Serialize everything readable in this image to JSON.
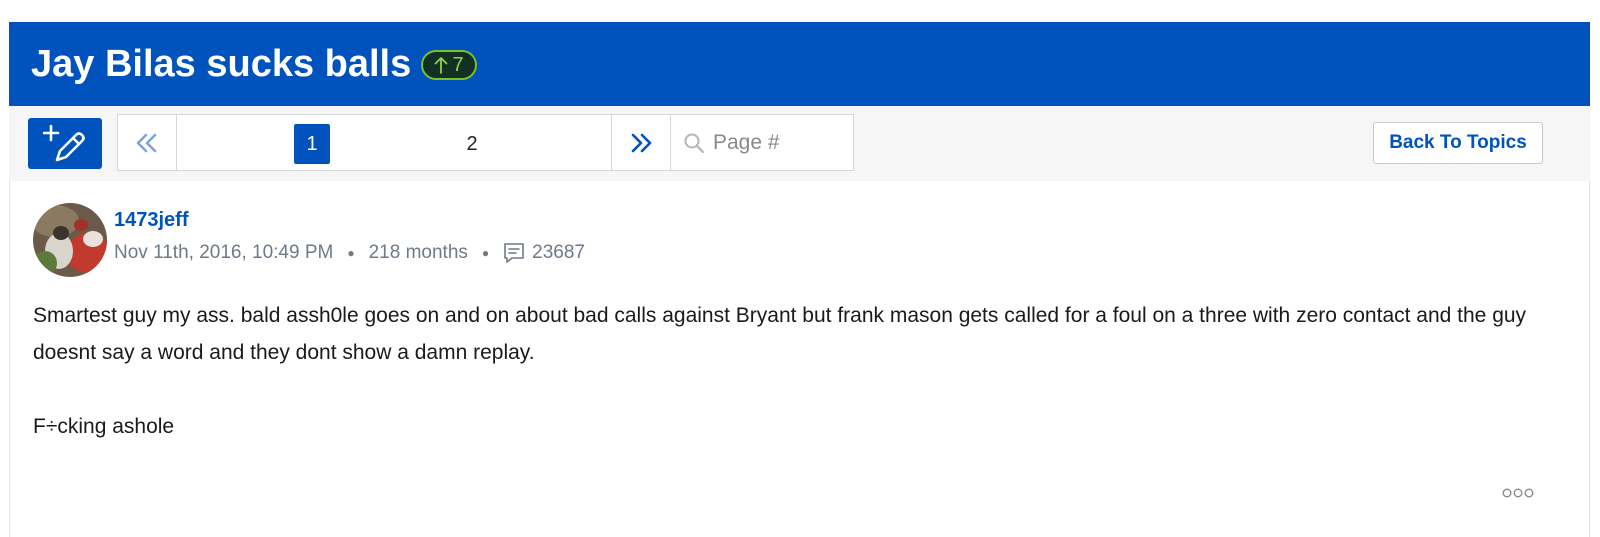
{
  "topic": {
    "title": "Jay Bilas sucks balls",
    "vote_count": "7"
  },
  "toolbar": {
    "new_post_icon": "new-post-pencil-icon",
    "pagination": {
      "first_icon": "double-chevron-left-icon",
      "next_icon": "double-chevron-right-icon",
      "pages": [
        "1",
        "2"
      ],
      "current_page": "1",
      "search_placeholder": "Page #"
    },
    "back_label": "Back To Topics"
  },
  "post": {
    "username": "1473jeff",
    "timestamp": "Nov 11th, 2016, 10:49 PM",
    "tenure": "218 months",
    "comment_count": "23687",
    "body": [
      "Smartest guy my ass. bald assh0le goes on and on about bad calls against Bryant but frank mason gets called for a foul on a three with zero contact and the guy doesnt  say a word and they dont show a damn replay.",
      "F÷cking ashole"
    ]
  },
  "colors": {
    "brand_blue": "#0053bd",
    "vote_green": "#8fd43c",
    "meta_gray": "#6e7a87"
  }
}
